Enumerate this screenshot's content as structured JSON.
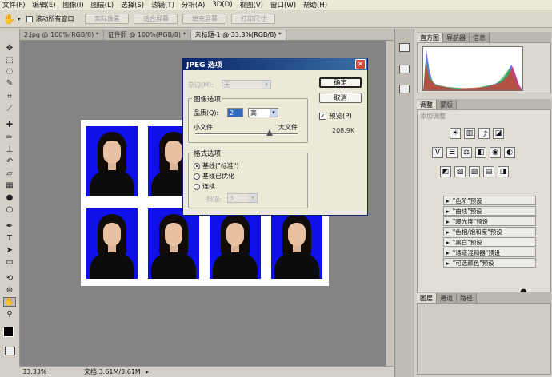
{
  "menu": [
    "文件(F)",
    "编辑(E)",
    "图像(I)",
    "图层(L)",
    "选择(S)",
    "滤镜(T)",
    "分析(A)",
    "3D(D)",
    "视图(V)",
    "窗口(W)",
    "帮助(H)"
  ],
  "options": {
    "scroll_all": "滚动所有窗口",
    "buttons": [
      "实际像素",
      "适合屏幕",
      "填充屏幕",
      "打印尺寸"
    ]
  },
  "tabs": [
    "2.jpg @ 100%(RGB/8) *",
    "证件照 @ 100%(RGB/8) *",
    "未标题-1 @ 33.3%(RGB/8) *"
  ],
  "status": {
    "zoom": "33.33%",
    "doc": "文档:3.61M/3.61M"
  },
  "right_panel": {
    "histogram_tabs": [
      "直方图",
      "导航器",
      "信息"
    ],
    "adjust_tabs": [
      "调整",
      "蒙版"
    ],
    "adjust_title": "添加调整",
    "presets": [
      "\"色阶\"预设",
      "\"曲线\"预设",
      "\"曝光度\"预设",
      "\"色相/饱和度\"预设",
      "\"黑白\"预设",
      "\"通道混和器\"预设",
      "\"可选颜色\"预设"
    ],
    "bottom_tabs": [
      "图层",
      "通道",
      "路径"
    ]
  },
  "dialog": {
    "title": "JPEG 选项",
    "matte_label": "杂边(M):",
    "matte_value": "无",
    "image_options": "图像选项",
    "quality_label": "品质(Q):",
    "quality_value": "2",
    "quality_preset": "高",
    "small_file": "小文件",
    "large_file": "大文件",
    "format_options": "格式选项",
    "fmt_baseline": "基线(\"标准\")",
    "fmt_optimized": "基线已优化",
    "fmt_progressive": "连续",
    "scans_label": "扫描:",
    "scans_value": "3",
    "ok": "确定",
    "cancel": "取消",
    "preview": "预览(P)",
    "filesize": "208.9K"
  },
  "colors": {
    "photo_bg": "#1010e8",
    "title_bar": "#0a246a"
  }
}
